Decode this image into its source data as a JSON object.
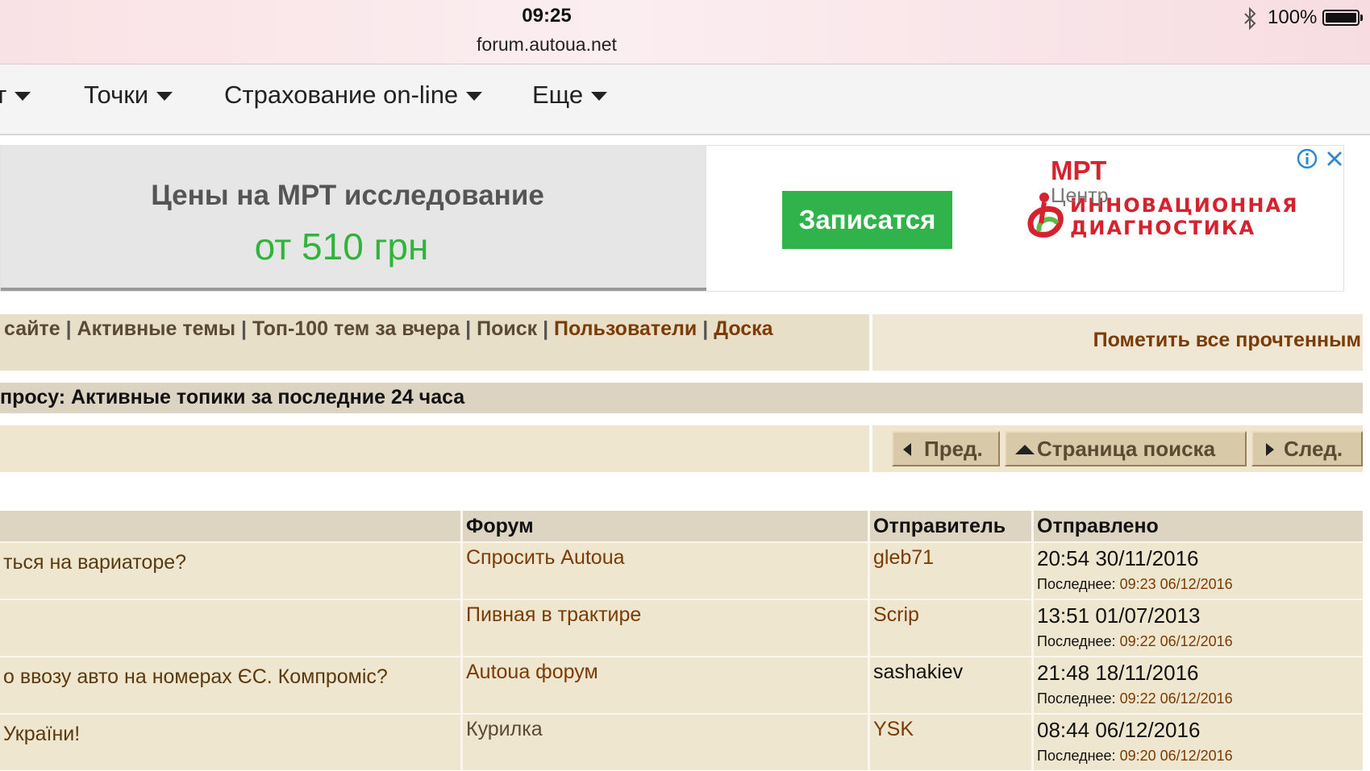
{
  "status_bar": {
    "time": "09:25",
    "url": "forum.autoua.net",
    "battery": "100%"
  },
  "nav": {
    "items": [
      {
        "label": "т"
      },
      {
        "label": "Точки"
      },
      {
        "label": "Страхование on-line"
      },
      {
        "label": "Еще"
      }
    ]
  },
  "ad": {
    "title": "Цены на МРТ исследование",
    "price": "от 510 грн",
    "button": "Записатся",
    "logo_line1": "ИННОВАЦИОННАЯ",
    "logo_line2": "ДИАГНОСТИКА",
    "logo_mrt": "МРТ",
    "logo_center": "Центр",
    "colors": {
      "accent_green": "#2fb34a",
      "price_green": "#30b43c",
      "logo_red": "#d4232e"
    }
  },
  "links": {
    "items": [
      {
        "label": "сайте"
      },
      {
        "label": "Активные темы"
      },
      {
        "label": "Топ-100 тем за вчера"
      },
      {
        "label": "Поиск"
      },
      {
        "label": "Пользователи"
      },
      {
        "label": "Доска"
      }
    ],
    "separator": " | ",
    "mark_read": "Пометить все прочтенным"
  },
  "search_title": "просу: Активные топики за последние 24 часа",
  "pagination": {
    "prev": "Пред.",
    "search_page": "Страница поиска",
    "next": "След."
  },
  "table": {
    "headers": {
      "topic": "",
      "forum": "Форум",
      "sender": "Отправитель",
      "sent": "Отправлено"
    },
    "last_label": "Последнее:",
    "rows": [
      {
        "topic": "ться на вариаторе?",
        "forum": "Спросить Autoua",
        "sender": "gleb71",
        "hm": "20:54",
        "date": "30/11/2016",
        "last": "09:23 06/12/2016"
      },
      {
        "topic": "",
        "forum": "Пивная в трактире",
        "sender": "Scrip",
        "hm": "13:51",
        "date": "01/07/2013",
        "last": "09:22 06/12/2016"
      },
      {
        "topic": "о ввозу авто на номерах ЄС. Компроміс?",
        "forum": "Autoua форум",
        "sender": "sashakiev",
        "hm": "21:48",
        "date": "18/11/2016",
        "last": "09:22 06/12/2016"
      },
      {
        "topic": " України!",
        "forum": "Курилка",
        "sender": "YSK",
        "hm": "08:44",
        "date": "06/12/2016",
        "last": "09:20 06/12/2016"
      }
    ]
  }
}
